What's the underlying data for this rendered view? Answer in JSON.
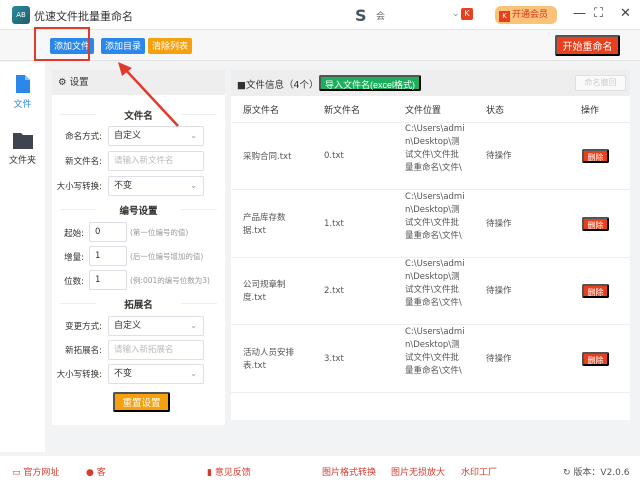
{
  "app": {
    "title": "优速文件批量重命名",
    "logo_text": "AB",
    "center_logo": "S",
    "center_text": "会",
    "vip": "开通会员",
    "vip_icon": "K"
  },
  "window": {
    "minimize": "—",
    "maximize": "⛶",
    "close": "✕"
  },
  "toolbar": {
    "add_file": "添加文件",
    "add_dir": "添加目录",
    "clear": "清除列表",
    "start": "开始重命名",
    "colors": {
      "blue": "#2b87e8",
      "orange": "#f5a00d",
      "red": "#e8401c"
    }
  },
  "sidebar": {
    "items": [
      {
        "label": "文件",
        "icon": "file-icon",
        "active": true
      },
      {
        "label": "文件夹",
        "icon": "folder-icon"
      }
    ]
  },
  "settings": {
    "title": "设置",
    "filename": {
      "heading": "文件名",
      "mode_label": "命名方式:",
      "mode_value": "自定义",
      "new_label": "新文件名:",
      "new_placeholder": "请输入新文件名",
      "case_label": "大小写转换:",
      "case_value": "不变"
    },
    "numbering": {
      "heading": "编号设置",
      "start_label": "起始:",
      "start_value": "0",
      "start_hint": "(第一位编号的值)",
      "step_label": "增量:",
      "step_value": "1",
      "step_hint": "(后一位编号增加的值)",
      "digits_label": "位数:",
      "digits_value": "1",
      "digits_hint": "(例:001的编号位数为3)"
    },
    "extension": {
      "heading": "拓展名",
      "mode_label": "变更方式:",
      "mode_value": "自定义",
      "new_label": "新拓展名:",
      "new_placeholder": "请输入新拓展名",
      "case_label": "大小写转换:",
      "case_value": "不变"
    },
    "reset": "重置设置"
  },
  "files": {
    "info": "文件信息（4个）",
    "import": "导入文件名(excel格式)",
    "undo": "命名撤回",
    "columns": [
      "原文件名",
      "新文件名",
      "文件位置",
      "状态",
      "操作"
    ],
    "rows": [
      {
        "orig": "采购合同.txt",
        "new": "0.txt",
        "path": "C:\\Users\\admin\\Desktop\\测试文件\\文件批量重命名\\文件\\",
        "status": "待操作",
        "action": "删除"
      },
      {
        "orig": "产品库存数据.txt",
        "new": "1.txt",
        "path": "C:\\Users\\admin\\Desktop\\测试文件\\文件批量重命名\\文件\\",
        "status": "待操作",
        "action": "删除"
      },
      {
        "orig": "公司规章制度.txt",
        "new": "2.txt",
        "path": "C:\\Users\\admin\\Desktop\\测试文件\\文件批量重命名\\文件\\",
        "status": "待操作",
        "action": "删除"
      },
      {
        "orig": "活动人员安排表.txt",
        "new": "3.txt",
        "path": "C:\\Users\\admin\\Desktop\\测试文件\\文件批量重命名\\文件\\",
        "status": "待操作",
        "action": "删除"
      }
    ]
  },
  "footer": {
    "website": "官方网址",
    "service": "客",
    "feedback": "意见反馈",
    "link1": "图片格式转换",
    "link2": "图片无损放大",
    "link3": "水印工厂",
    "version": "版本：V2.0.6"
  }
}
